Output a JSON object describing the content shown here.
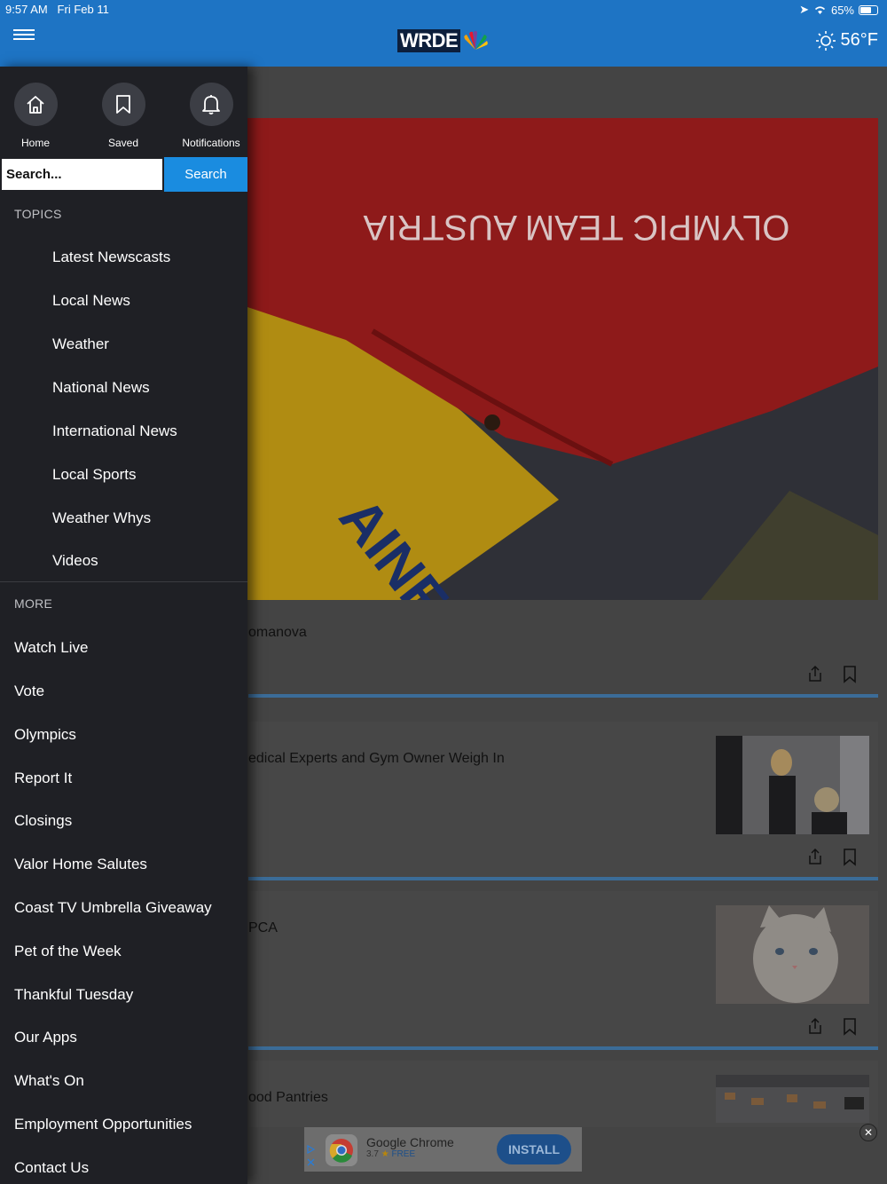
{
  "status": {
    "time": "9:57 AM",
    "date": "Fri Feb 11",
    "battery": "65%"
  },
  "header": {
    "logo": "WRDE",
    "temperature": "56°F"
  },
  "drawer": {
    "quick_links": [
      {
        "label": "Home"
      },
      {
        "label": "Saved"
      },
      {
        "label": "Notifications"
      }
    ],
    "search": {
      "placeholder": "Search...",
      "button": "Search"
    },
    "topics_heading": "TOPICS",
    "topics": [
      "Latest Newscasts",
      "Local News",
      "Weather",
      "National News",
      "International News",
      "Local Sports",
      "Weather Whys",
      "Videos"
    ],
    "more_heading": "MORE",
    "more": [
      "Watch Live",
      "Vote",
      "Olympics",
      "Report It",
      "Closings",
      "Valor Home Salutes",
      "Coast TV Umbrella Giveaway",
      "Pet of the Week",
      "Thankful Tuesday",
      "Our Apps",
      "What's On",
      "Employment Opportunities",
      "Contact Us"
    ]
  },
  "content": {
    "hero_text": {
      "jacket": "OLYMPIC TEAM AUSTRIA",
      "shirt": "AINE"
    },
    "cards": [
      {
        "title": "omanova"
      },
      {
        "title": "edical Experts and Gym Owner Weigh In"
      },
      {
        "title": "PCA"
      },
      {
        "title": "ood Pantries"
      }
    ]
  },
  "ad": {
    "app_name": "Google Chrome",
    "rating": "3.7",
    "price": "FREE",
    "button": "INSTALL"
  }
}
